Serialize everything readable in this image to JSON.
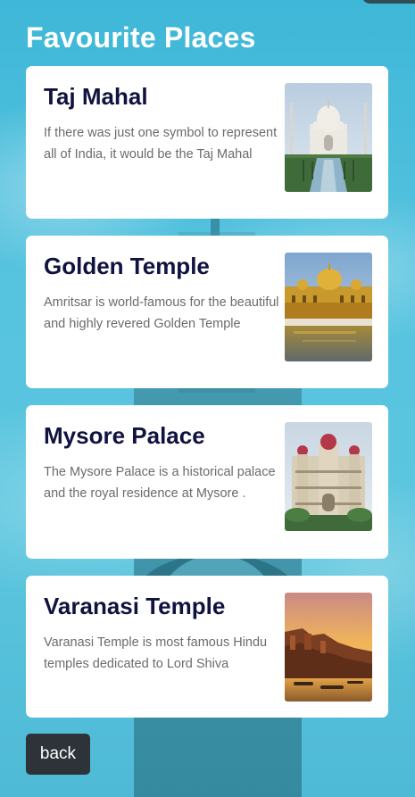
{
  "page": {
    "title": "Favourite Places"
  },
  "places": [
    {
      "title": "Taj Mahal",
      "description": "If there was just one symbol to represent all of India, it would be the Taj Mahal",
      "image": "taj-mahal-photo"
    },
    {
      "title": "Golden Temple",
      "description": "Amritsar is world-famous for the beautiful and highly revered Golden Temple",
      "image": "golden-temple-photo"
    },
    {
      "title": "Mysore Palace",
      "description": "The Mysore Palace is a historical palace and the royal residence at Mysore .",
      "image": "mysore-palace-photo"
    },
    {
      "title": "Varanasi Temple",
      "description": "Varanasi Temple is most famous Hindu temples dedicated to Lord Shiva",
      "image": "varanasi-ghats-photo"
    }
  ],
  "actions": {
    "back_label": "back"
  },
  "colors": {
    "background": "#4cc0dd",
    "card": "#ffffff",
    "title_text": "#10123f",
    "body_text": "#6b6b6b",
    "button": "#2d3338"
  }
}
